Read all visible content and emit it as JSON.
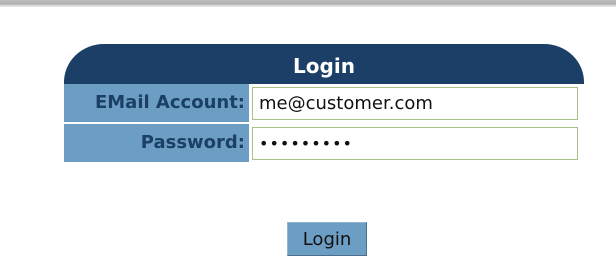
{
  "header": {
    "title": "Login"
  },
  "form": {
    "email_label": "EMail Account:",
    "email_value": "me@customer.com",
    "password_label": "Password:",
    "password_value": "123456789"
  },
  "actions": {
    "login_label": "Login"
  },
  "colors": {
    "header_background": "#1b3f66",
    "label_background": "#6c9ec4",
    "input_border": "#a9bf8a"
  }
}
